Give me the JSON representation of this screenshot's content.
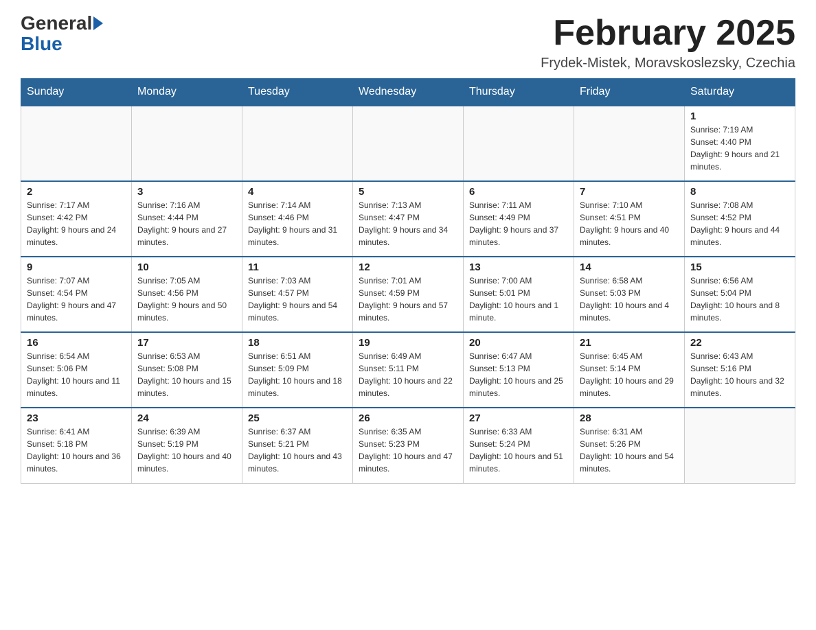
{
  "logo": {
    "general": "General",
    "blue": "Blue"
  },
  "title": "February 2025",
  "subtitle": "Frydek-Mistek, Moravskoslezsky, Czechia",
  "days_of_week": [
    "Sunday",
    "Monday",
    "Tuesday",
    "Wednesday",
    "Thursday",
    "Friday",
    "Saturday"
  ],
  "weeks": [
    [
      {
        "day": "",
        "info": ""
      },
      {
        "day": "",
        "info": ""
      },
      {
        "day": "",
        "info": ""
      },
      {
        "day": "",
        "info": ""
      },
      {
        "day": "",
        "info": ""
      },
      {
        "day": "",
        "info": ""
      },
      {
        "day": "1",
        "info": "Sunrise: 7:19 AM\nSunset: 4:40 PM\nDaylight: 9 hours and 21 minutes."
      }
    ],
    [
      {
        "day": "2",
        "info": "Sunrise: 7:17 AM\nSunset: 4:42 PM\nDaylight: 9 hours and 24 minutes."
      },
      {
        "day": "3",
        "info": "Sunrise: 7:16 AM\nSunset: 4:44 PM\nDaylight: 9 hours and 27 minutes."
      },
      {
        "day": "4",
        "info": "Sunrise: 7:14 AM\nSunset: 4:46 PM\nDaylight: 9 hours and 31 minutes."
      },
      {
        "day": "5",
        "info": "Sunrise: 7:13 AM\nSunset: 4:47 PM\nDaylight: 9 hours and 34 minutes."
      },
      {
        "day": "6",
        "info": "Sunrise: 7:11 AM\nSunset: 4:49 PM\nDaylight: 9 hours and 37 minutes."
      },
      {
        "day": "7",
        "info": "Sunrise: 7:10 AM\nSunset: 4:51 PM\nDaylight: 9 hours and 40 minutes."
      },
      {
        "day": "8",
        "info": "Sunrise: 7:08 AM\nSunset: 4:52 PM\nDaylight: 9 hours and 44 minutes."
      }
    ],
    [
      {
        "day": "9",
        "info": "Sunrise: 7:07 AM\nSunset: 4:54 PM\nDaylight: 9 hours and 47 minutes."
      },
      {
        "day": "10",
        "info": "Sunrise: 7:05 AM\nSunset: 4:56 PM\nDaylight: 9 hours and 50 minutes."
      },
      {
        "day": "11",
        "info": "Sunrise: 7:03 AM\nSunset: 4:57 PM\nDaylight: 9 hours and 54 minutes."
      },
      {
        "day": "12",
        "info": "Sunrise: 7:01 AM\nSunset: 4:59 PM\nDaylight: 9 hours and 57 minutes."
      },
      {
        "day": "13",
        "info": "Sunrise: 7:00 AM\nSunset: 5:01 PM\nDaylight: 10 hours and 1 minute."
      },
      {
        "day": "14",
        "info": "Sunrise: 6:58 AM\nSunset: 5:03 PM\nDaylight: 10 hours and 4 minutes."
      },
      {
        "day": "15",
        "info": "Sunrise: 6:56 AM\nSunset: 5:04 PM\nDaylight: 10 hours and 8 minutes."
      }
    ],
    [
      {
        "day": "16",
        "info": "Sunrise: 6:54 AM\nSunset: 5:06 PM\nDaylight: 10 hours and 11 minutes."
      },
      {
        "day": "17",
        "info": "Sunrise: 6:53 AM\nSunset: 5:08 PM\nDaylight: 10 hours and 15 minutes."
      },
      {
        "day": "18",
        "info": "Sunrise: 6:51 AM\nSunset: 5:09 PM\nDaylight: 10 hours and 18 minutes."
      },
      {
        "day": "19",
        "info": "Sunrise: 6:49 AM\nSunset: 5:11 PM\nDaylight: 10 hours and 22 minutes."
      },
      {
        "day": "20",
        "info": "Sunrise: 6:47 AM\nSunset: 5:13 PM\nDaylight: 10 hours and 25 minutes."
      },
      {
        "day": "21",
        "info": "Sunrise: 6:45 AM\nSunset: 5:14 PM\nDaylight: 10 hours and 29 minutes."
      },
      {
        "day": "22",
        "info": "Sunrise: 6:43 AM\nSunset: 5:16 PM\nDaylight: 10 hours and 32 minutes."
      }
    ],
    [
      {
        "day": "23",
        "info": "Sunrise: 6:41 AM\nSunset: 5:18 PM\nDaylight: 10 hours and 36 minutes."
      },
      {
        "day": "24",
        "info": "Sunrise: 6:39 AM\nSunset: 5:19 PM\nDaylight: 10 hours and 40 minutes."
      },
      {
        "day": "25",
        "info": "Sunrise: 6:37 AM\nSunset: 5:21 PM\nDaylight: 10 hours and 43 minutes."
      },
      {
        "day": "26",
        "info": "Sunrise: 6:35 AM\nSunset: 5:23 PM\nDaylight: 10 hours and 47 minutes."
      },
      {
        "day": "27",
        "info": "Sunrise: 6:33 AM\nSunset: 5:24 PM\nDaylight: 10 hours and 51 minutes."
      },
      {
        "day": "28",
        "info": "Sunrise: 6:31 AM\nSunset: 5:26 PM\nDaylight: 10 hours and 54 minutes."
      },
      {
        "day": "",
        "info": ""
      }
    ]
  ]
}
